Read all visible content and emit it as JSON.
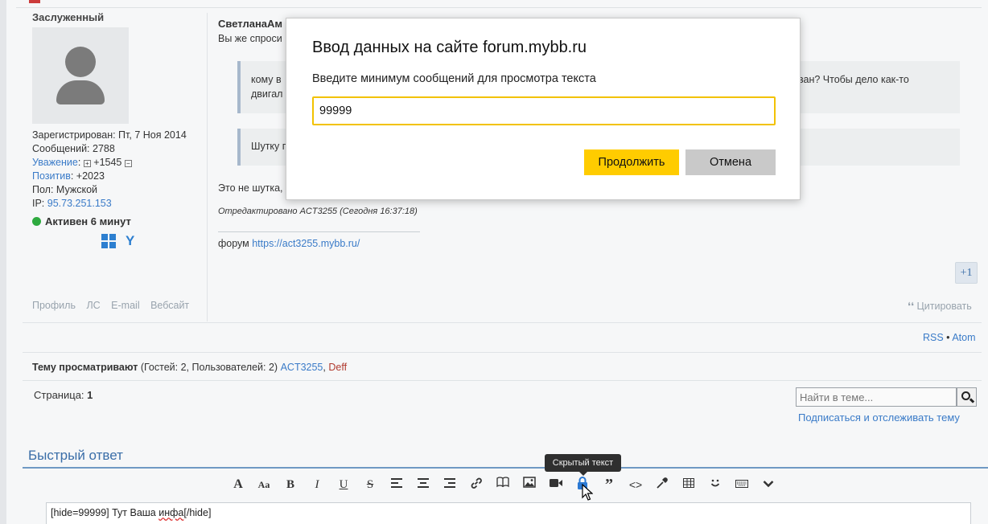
{
  "post": {
    "user_title": "Заслуженный",
    "info": {
      "registered": "Зарегистрирован: Пт, 7 Ноя 2014",
      "messages": "Сообщений: 2788",
      "respect_label": "Уважение",
      "respect_value": "+1545",
      "positive_label": "Позитив",
      "positive_value": ": +2023",
      "gender": "Пол: Мужской",
      "ip_label": "IP: ",
      "ip_value": "95.73.251.153"
    },
    "online": "Активен 6 минут",
    "links": [
      "Профиль",
      "ЛС",
      "E-mail",
      "Вебсайт"
    ],
    "author": "СветланаАм",
    "text1": "Вы же спроси",
    "quote1_line1": "кому в",
    "quote1_line2": "двигал",
    "quote1_tail": "ван? Чтобы дело как-то",
    "quote2_line1": "Шутку п",
    "text2": "Это не шутка,",
    "edited": "Отредактировано ACT3255 (Сегодня 16:37:18)",
    "sig_prefix": "форум ",
    "sig_link": "https://act3255.mybb.ru/",
    "plus_one": "+1",
    "quote_link": "Цитировать"
  },
  "feeds": {
    "rss": "RSS",
    "sep": " • ",
    "atom": "Atom"
  },
  "viewers": {
    "label": "Тему просматривают",
    "counts": " (Гостей: 2, Пользователей: 2) ",
    "user1": "ACT3255",
    "comma": ", ",
    "user2": "Deff"
  },
  "pagination": {
    "label": "Страница: ",
    "current": "1"
  },
  "search": {
    "placeholder": "Найти в теме..."
  },
  "subscribe": "Подписаться и отслеживать тему",
  "quick_reply": {
    "title": "Быстрый ответ",
    "tooltip": "Скрытый текст",
    "editor_before": "[hide=99999] Тут Ваша ",
    "editor_squiggle": "инфа",
    "editor_after": "[/hide]",
    "toolbar_icons": [
      "font-icon",
      "font-size-icon",
      "bold-icon",
      "italic-icon",
      "underline-icon",
      "strikethrough-icon",
      "align-left-icon",
      "align-center-icon",
      "align-right-icon",
      "link-icon",
      "book-icon",
      "image-icon",
      "video-icon",
      "lock-icon",
      "quote-icon",
      "code-icon",
      "color-picker-icon",
      "table-icon",
      "smiley-icon",
      "keyboard-icon",
      "more-icon"
    ]
  },
  "modal": {
    "title": "Ввод данных на сайте forum.mybb.ru",
    "prompt": "Введите минимум сообщений для просмотра текста",
    "input_value": "99999",
    "ok_label": "Продолжить",
    "cancel_label": "Отмена",
    "accent_color": "#ffcc00"
  }
}
